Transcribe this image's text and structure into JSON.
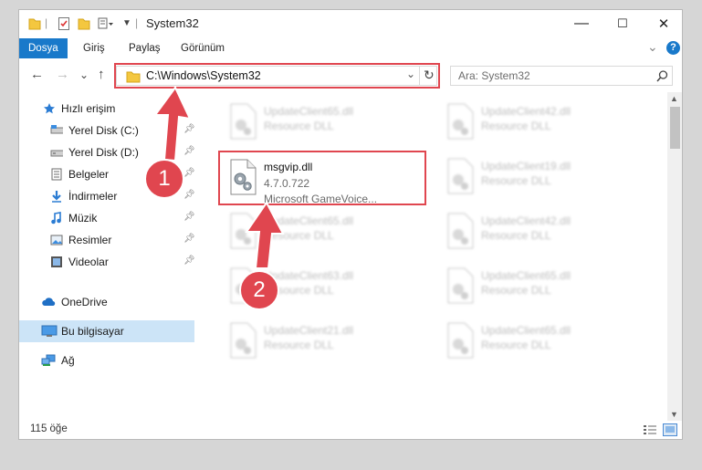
{
  "window": {
    "title": "System32",
    "minimize": "—",
    "maximize": "☐",
    "close": "✕"
  },
  "ribbon": {
    "tabs": [
      {
        "label": "Dosya"
      },
      {
        "label": "Giriş"
      },
      {
        "label": "Paylaş"
      },
      {
        "label": "Görünüm"
      }
    ],
    "collapse": "⌄",
    "help": "?"
  },
  "nav": {
    "back": "←",
    "forward": "→",
    "recent": "⌄",
    "up": "↑",
    "address": "C:\\Windows\\System32",
    "address_dropdown": "⌄",
    "refresh": "↻",
    "search_placeholder": "Ara: System32"
  },
  "sidebar": {
    "items": [
      {
        "label": "Hızlı erişim",
        "icon": "star-icon"
      },
      {
        "label": "Yerel Disk (C:)",
        "icon": "drive-icon",
        "pinned": true
      },
      {
        "label": "Yerel Disk (D:)",
        "icon": "drive-icon",
        "pinned": true
      },
      {
        "label": "Belgeler",
        "icon": "documents-icon",
        "pinned": true
      },
      {
        "label": "İndirmeler",
        "icon": "download-icon",
        "pinned": true
      },
      {
        "label": "Müzik",
        "icon": "music-icon",
        "pinned": true
      },
      {
        "label": "Resimler",
        "icon": "pictures-icon",
        "pinned": true
      },
      {
        "label": "Videolar",
        "icon": "videos-icon",
        "pinned": true
      },
      {
        "label": "OneDrive",
        "icon": "cloud-icon"
      },
      {
        "label": "Bu bilgisayar",
        "icon": "computer-icon",
        "selected": true
      },
      {
        "label": "Ağ",
        "icon": "network-icon"
      }
    ]
  },
  "files": [
    {
      "name": "UpdateClient65.dll",
      "sub": "Resource DLL",
      "focus": false
    },
    {
      "name": "UpdateClient42.dll",
      "sub": "Resource DLL",
      "focus": false
    },
    {
      "name": "msgvip.dll",
      "version": "4.7.0.722",
      "sub": "Microsoft GameVoice...",
      "focus": true
    },
    {
      "name": "UpdateClient19.dll",
      "sub": "Resource DLL",
      "focus": false
    },
    {
      "name": "UpdateClient65.dll",
      "sub": "Resource DLL",
      "focus": false
    },
    {
      "name": "UpdateClient42.dll",
      "sub": "Resource DLL",
      "focus": false
    },
    {
      "name": "UpdateClient63.dll",
      "sub": "Resource DLL",
      "focus": false
    },
    {
      "name": "UpdateClient65.dll",
      "sub": "Resource DLL",
      "focus": false
    },
    {
      "name": "UpdateClient21.dll",
      "sub": "Resource DLL",
      "focus": false
    },
    {
      "name": "UpdateClient65.dll",
      "sub": "Resource DLL",
      "focus": false
    }
  ],
  "status": {
    "count": "115 öğe"
  },
  "annotations": {
    "step1": "1",
    "step2": "2",
    "color": "#e0464f"
  }
}
